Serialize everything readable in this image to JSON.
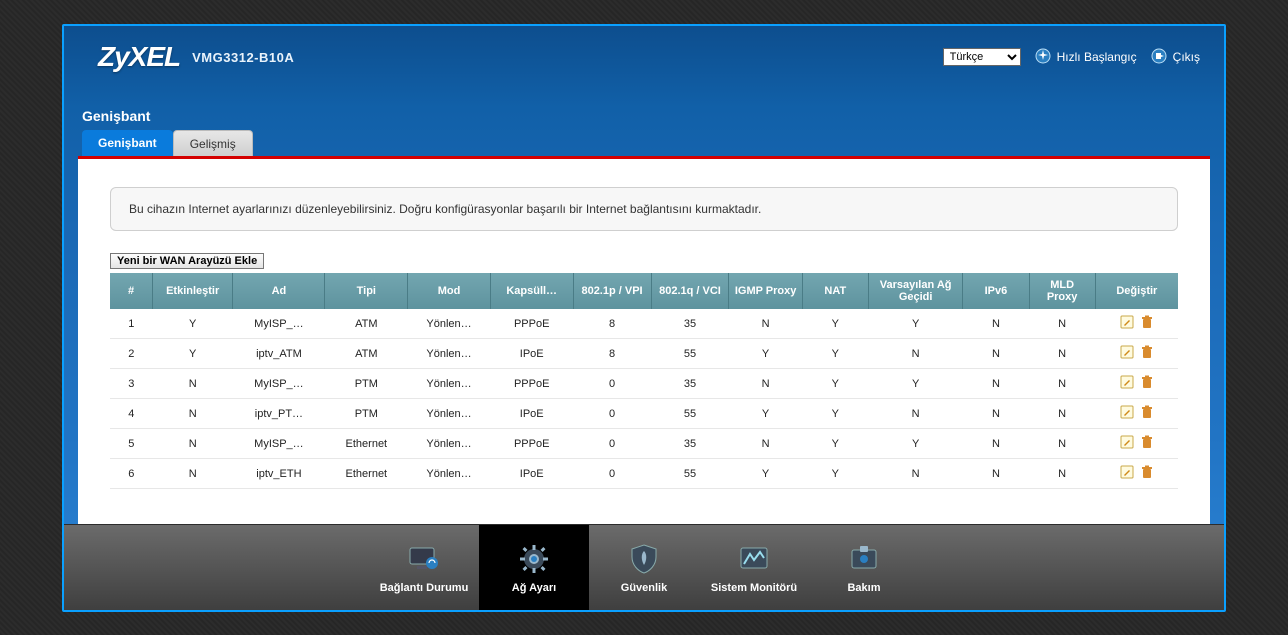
{
  "header": {
    "brand": "ZyXEL",
    "model": "VMG3312-B10A",
    "language_selected": "Türkçe",
    "quick_start": "Hızlı Başlangıç",
    "logout": "Çıkış"
  },
  "page": {
    "title": "Genişbant",
    "tabs": [
      {
        "label": "Genişbant",
        "active": true
      },
      {
        "label": "Gelişmiş",
        "active": false
      }
    ],
    "description": "Bu cihazın Internet ayarlarınızı düzenleyebilirsiniz. Doğru konfigürasyonlar başarılı bir Internet bağlantısını kurmaktadır.",
    "add_button": "Yeni bir WAN Arayüzü  Ekle"
  },
  "table": {
    "columns": [
      "#",
      "Etkinleştir",
      "Ad",
      "Tipi",
      "Mod",
      "Kapsüll…",
      "802.1p / VPI",
      "802.1q / VCI",
      "IGMP Proxy",
      "NAT",
      "Varsayılan Ağ Geçidi",
      "IPv6",
      "MLD Proxy",
      "Değiştir"
    ],
    "rows": [
      {
        "idx": "1",
        "enable": "Y",
        "name": "MyISP_…",
        "type": "ATM",
        "mode": "Yönlen…",
        "encap": "PPPoE",
        "vpi": "8",
        "vci": "35",
        "igmp": "N",
        "nat": "Y",
        "gw": "Y",
        "ipv6": "N",
        "mld": "N"
      },
      {
        "idx": "2",
        "enable": "Y",
        "name": "iptv_ATM",
        "type": "ATM",
        "mode": "Yönlen…",
        "encap": "IPoE",
        "vpi": "8",
        "vci": "55",
        "igmp": "Y",
        "nat": "Y",
        "gw": "N",
        "ipv6": "N",
        "mld": "N"
      },
      {
        "idx": "3",
        "enable": "N",
        "name": "MyISP_…",
        "type": "PTM",
        "mode": "Yönlen…",
        "encap": "PPPoE",
        "vpi": "0",
        "vci": "35",
        "igmp": "N",
        "nat": "Y",
        "gw": "Y",
        "ipv6": "N",
        "mld": "N"
      },
      {
        "idx": "4",
        "enable": "N",
        "name": "iptv_PT…",
        "type": "PTM",
        "mode": "Yönlen…",
        "encap": "IPoE",
        "vpi": "0",
        "vci": "55",
        "igmp": "Y",
        "nat": "Y",
        "gw": "N",
        "ipv6": "N",
        "mld": "N"
      },
      {
        "idx": "5",
        "enable": "N",
        "name": "MyISP_…",
        "type": "Ethernet",
        "mode": "Yönlen…",
        "encap": "PPPoE",
        "vpi": "0",
        "vci": "35",
        "igmp": "N",
        "nat": "Y",
        "gw": "Y",
        "ipv6": "N",
        "mld": "N"
      },
      {
        "idx": "6",
        "enable": "N",
        "name": "iptv_ETH",
        "type": "Ethernet",
        "mode": "Yönlen…",
        "encap": "IPoE",
        "vpi": "0",
        "vci": "55",
        "igmp": "Y",
        "nat": "Y",
        "gw": "N",
        "ipv6": "N",
        "mld": "N"
      }
    ]
  },
  "bottomnav": {
    "items": [
      {
        "label": "Bağlantı Durumu",
        "active": false
      },
      {
        "label": "Ağ Ayarı",
        "active": true
      },
      {
        "label": "Güvenlik",
        "active": false
      },
      {
        "label": "Sistem Monitörü",
        "active": false
      },
      {
        "label": "Bakım",
        "active": false
      }
    ]
  }
}
